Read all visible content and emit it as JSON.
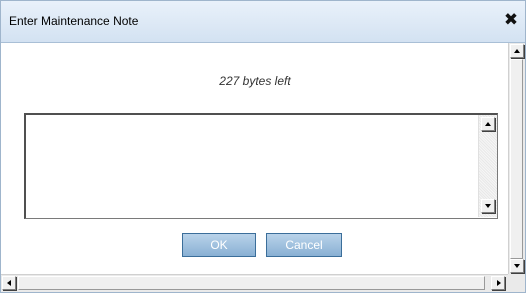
{
  "dialog": {
    "title": "Enter Maintenance Note",
    "close_icon": "close-x-icon",
    "close_glyph": "✖"
  },
  "note": {
    "bytes_left": "227 bytes left",
    "value": "",
    "placeholder": ""
  },
  "buttons": {
    "ok_label": "OK",
    "cancel_label": "Cancel"
  },
  "colors": {
    "titlebar": "#d3e2f2",
    "button": "#89b0d4",
    "button_text": "#ffffff"
  }
}
